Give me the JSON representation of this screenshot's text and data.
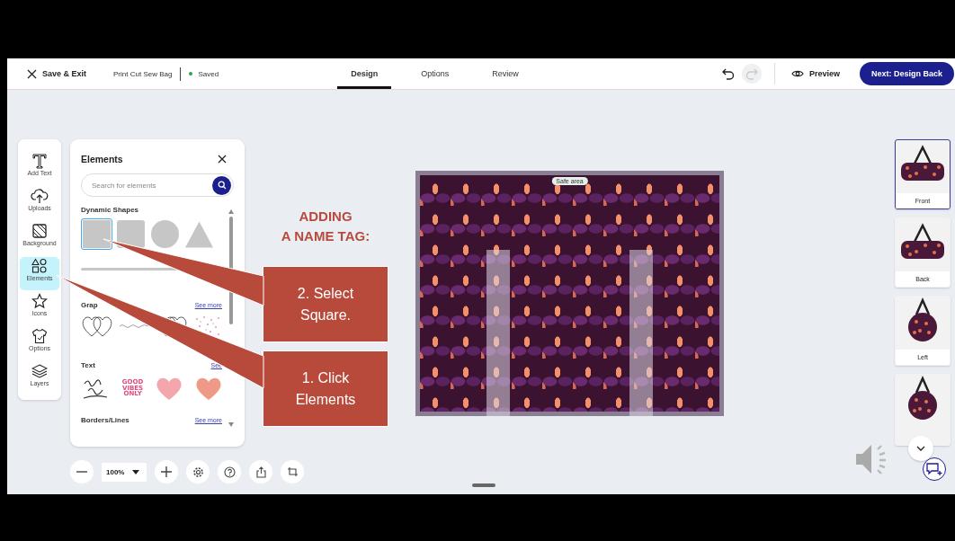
{
  "header": {
    "close_label": "Save & Exit",
    "project_name": "Print Cut Sew Bag",
    "status": "Saved",
    "tabs": [
      {
        "label": "Design",
        "selected": true
      },
      {
        "label": "Options",
        "selected": false
      },
      {
        "label": "Review",
        "selected": false
      }
    ],
    "undo": {
      "disabled": false
    },
    "redo": {
      "disabled": true
    },
    "preview_label": "Preview",
    "next_button": "Next: Design Back"
  },
  "tool_rail": [
    {
      "kind": "text",
      "label": "Add Text",
      "selected": false
    },
    {
      "kind": "upload",
      "label": "Uploads",
      "selected": false
    },
    {
      "kind": "background",
      "label": "Background",
      "selected": false
    },
    {
      "kind": "elements",
      "label": "Elements",
      "selected": true
    },
    {
      "kind": "star",
      "label": "Icons",
      "selected": false
    },
    {
      "kind": "shirt",
      "label": "Options",
      "selected": false
    },
    {
      "kind": "layers",
      "label": "Layers",
      "selected": false
    }
  ],
  "panel": {
    "title": "Elements",
    "search": {
      "placeholder": "Search for elements"
    },
    "sections": [
      {
        "kind": "shapes",
        "title": "Dynamic Shapes",
        "items": [
          {
            "kind": "square",
            "selected": true
          },
          {
            "kind": "rounded",
            "selected": false
          },
          {
            "kind": "circle",
            "selected": false
          },
          {
            "kind": "triangle",
            "selected": false
          },
          {
            "kind": "line",
            "selected": false
          }
        ]
      },
      {
        "kind": "graphics",
        "title": "Grap",
        "link": "See more",
        "items": [
          {
            "kind": "hearts"
          },
          {
            "kind": "scribble"
          },
          {
            "kind": "hearts"
          },
          {
            "kind": "confetti"
          }
        ]
      },
      {
        "kind": "stickers",
        "title": "Text",
        "link": "See",
        "items": [
          {
            "kind": "script"
          },
          {
            "kind": "words",
            "text": "GOOD\nVIBES\nONLY"
          },
          {
            "kind": "heart",
            "color": "#f4a6ad"
          },
          {
            "kind": "heart",
            "color": "#ee9a86"
          }
        ]
      },
      {
        "kind": "borders",
        "title": "Borders/Lines",
        "link": "See more"
      }
    ]
  },
  "annotation": {
    "title": "ADDING\nA NAME TAG:",
    "callouts": [
      "2. Select\nSquare.",
      "1. Click\nElements"
    ]
  },
  "canvas": {
    "safe_area_label": "Safe area"
  },
  "views": [
    {
      "kind": "side",
      "label": "Front",
      "selected": true
    },
    {
      "kind": "side",
      "label": "Back",
      "selected": false
    },
    {
      "kind": "end",
      "label": "Left",
      "selected": false
    },
    {
      "kind": "end",
      "selected": false
    }
  ],
  "zoom": {
    "value": "100%"
  }
}
